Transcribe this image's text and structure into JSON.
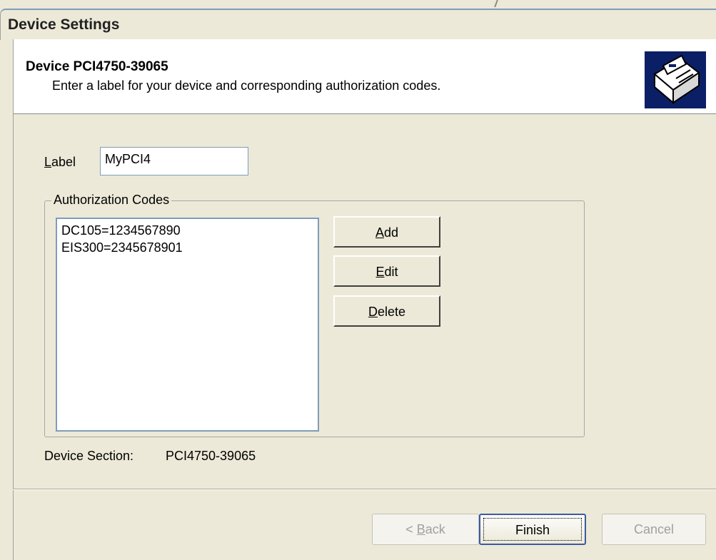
{
  "window": {
    "title": "Device Settings"
  },
  "header": {
    "title": "Device PCI4750-39065",
    "subtitle": "Enter a label for your device and corresponding authorization codes.",
    "icon": "device-wizard-icon"
  },
  "label_field": {
    "label_prefix": "L",
    "label_rest": "abel",
    "value": "MyPCI4"
  },
  "auth_codes": {
    "group_title": "Authorization Codes",
    "items": [
      "DC105=1234567890",
      "EIS300=2345678901"
    ]
  },
  "side_buttons": {
    "add": {
      "u": "A",
      "rest": "dd"
    },
    "edit": {
      "u": "E",
      "rest": "dit"
    },
    "delete": {
      "u": "D",
      "rest": "elete"
    }
  },
  "device_section": {
    "label": "Device Section:",
    "value": "PCI4750-39065"
  },
  "footer_buttons": {
    "back": {
      "pre": "< ",
      "u": "B",
      "rest": "ack"
    },
    "finish": "Finish",
    "cancel": "Cancel"
  }
}
